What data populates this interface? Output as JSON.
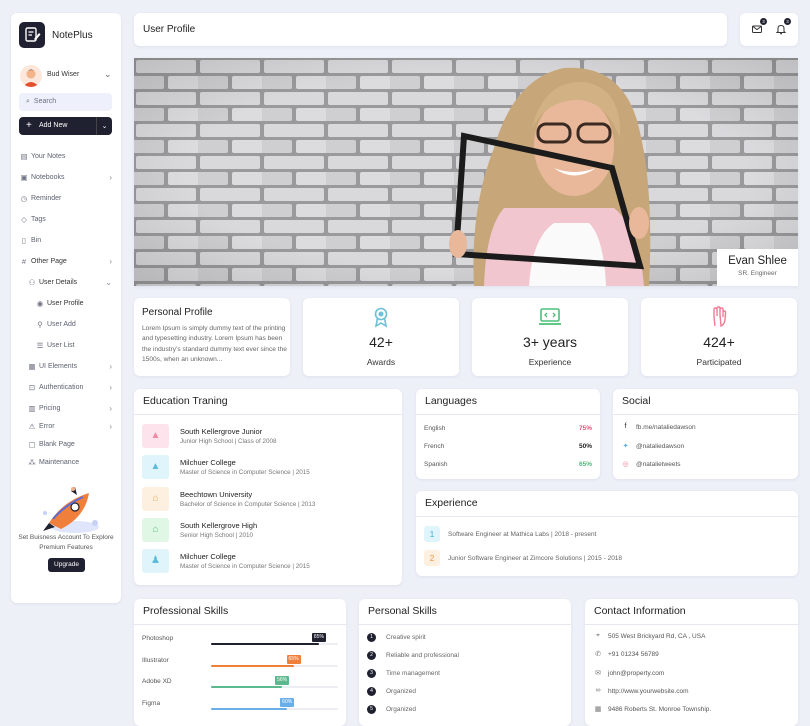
{
  "app": {
    "name": "NotePlus"
  },
  "user": {
    "name": "Bud Wiser"
  },
  "search": {
    "placeholder": "Search"
  },
  "add_new": {
    "label": "Add New"
  },
  "sidebar": {
    "items": [
      {
        "label": "Your Notes",
        "icon": "notes-icon",
        "chevron": false
      },
      {
        "label": "Notebooks",
        "icon": "notebook-icon",
        "chevron": true
      },
      {
        "label": "Reminder",
        "icon": "clock-icon",
        "chevron": false
      },
      {
        "label": "Tags",
        "icon": "tag-icon",
        "chevron": false
      },
      {
        "label": "Bin",
        "icon": "trash-icon",
        "chevron": false
      },
      {
        "label": "Other Page",
        "icon": "hash-icon",
        "chevron": true
      },
      {
        "label": "User Details",
        "icon": "users-icon",
        "chevron": true
      },
      {
        "label": "User Profile",
        "icon": "user-circle-icon",
        "chevron": false
      },
      {
        "label": "User Add",
        "icon": "user-add-icon",
        "chevron": false
      },
      {
        "label": "User List",
        "icon": "list-icon",
        "chevron": false
      },
      {
        "label": "UI Elements",
        "icon": "ui-icon",
        "chevron": true
      },
      {
        "label": "Authentication",
        "icon": "lock-icon",
        "chevron": true
      },
      {
        "label": "Pricing",
        "icon": "pricing-icon",
        "chevron": true
      },
      {
        "label": "Error",
        "icon": "error-icon",
        "chevron": true
      },
      {
        "label": "Blank Page",
        "icon": "blank-page-icon",
        "chevron": false
      },
      {
        "label": "Maintenance",
        "icon": "maintenance-icon",
        "chevron": false
      }
    ],
    "promo_text": "Set Buisness Account To Explore Premium Features",
    "upgrade_label": "Upgrade"
  },
  "header": {
    "title": "User Profile",
    "mail_badge": "3",
    "bell_badge": "3"
  },
  "hero": {
    "name": "Evan Shlee",
    "role": "SR. Engineer"
  },
  "personal_profile": {
    "title": "Personal Profile",
    "text": "Lorem Ipsum is simply dummy text of the printing and typesetting industry. Lorem Ipsum has been the industry's standard dummy text ever since the 1500s, when an unknown..."
  },
  "stats": [
    {
      "value": "42+",
      "label": "Awards",
      "icon": "award-icon",
      "color": "#6dc0d5"
    },
    {
      "value": "3+ years",
      "label": "Experience",
      "icon": "laptop-code-icon",
      "color": "#4cc07a"
    },
    {
      "value": "424+",
      "label": "Participated",
      "icon": "hand-icon",
      "color": "#ef7b95"
    }
  ],
  "education": {
    "title": "Education Traning",
    "items": [
      {
        "name": "South Kellergrove Junior",
        "detail": "Junior High School | Class of 2008",
        "bg": "#fde4ec",
        "fg": "#ef8aa6",
        "icon": "graduation-cap-icon"
      },
      {
        "name": "Milchuer College",
        "detail": "Master of Science in Computer Science | 2015",
        "bg": "#dff4fb",
        "fg": "#5bbbd8",
        "icon": "graduation-cap-icon"
      },
      {
        "name": "Beechtown University",
        "detail": "Bachelor of Science in Computer Science | 2013",
        "bg": "#fdf0e0",
        "fg": "#f2a95a",
        "icon": "university-icon"
      },
      {
        "name": "South Kellergrove High",
        "detail": "Senior High School | 2010",
        "bg": "#e1f7e6",
        "fg": "#56c27a",
        "icon": "school-icon"
      },
      {
        "name": "Milchuer College",
        "detail": "Master of Science in Computer Science | 2015",
        "bg": "#dff4fb",
        "fg": "#5bbbd8",
        "icon": "graduate-icon"
      }
    ]
  },
  "languages": {
    "title": "Languages",
    "items": [
      {
        "name": "English",
        "percent": "75%",
        "color": "#e8527a"
      },
      {
        "name": "French",
        "percent": "50%",
        "color": "#222222"
      },
      {
        "name": "Spanish",
        "percent": "65%",
        "color": "#4cb878"
      }
    ]
  },
  "social": {
    "title": "Social",
    "items": [
      {
        "text": "fb.me/nataliedawson",
        "icon": "facebook-icon",
        "color": "#222222"
      },
      {
        "text": "@nataliedawson",
        "icon": "twitter-icon",
        "color": "#5aa9e6"
      },
      {
        "text": "@natalietweets",
        "icon": "instagram-icon",
        "color": "#ef7b95"
      }
    ]
  },
  "experience": {
    "title": "Experience",
    "items": [
      {
        "num": "1",
        "text": "Software Engineer at Mathica Labs | 2018 - present",
        "bg": "#dff4fb",
        "fg": "#4aaed0"
      },
      {
        "num": "2",
        "text": "Junior Software Engineer at Zimcore Solutions | 2015 - 2018",
        "bg": "#fdf0e0",
        "fg": "#e89548"
      }
    ]
  },
  "professional_skills": {
    "title": "Professional Skills",
    "items": [
      {
        "name": "Photoshop",
        "percent": 85,
        "label": "85%",
        "color": "#1f2030"
      },
      {
        "name": "Illustrator",
        "percent": 65,
        "label": "65%",
        "color": "#f07f3c"
      },
      {
        "name": "Adobe XD",
        "percent": 56,
        "label": "56%",
        "color": "#5cb98d"
      },
      {
        "name": "Figma",
        "percent": 60,
        "label": "60%",
        "color": "#6aaee8"
      }
    ]
  },
  "personal_skills": {
    "title": "Personal Skills",
    "items": [
      {
        "num": "1",
        "text": "Creative spirit"
      },
      {
        "num": "2",
        "text": "Reliable and professional"
      },
      {
        "num": "3",
        "text": "Time management"
      },
      {
        "num": "4",
        "text": "Organized"
      },
      {
        "num": "5",
        "text": "Organized"
      }
    ]
  },
  "contact": {
    "title": "Contact Information",
    "items": [
      {
        "text": "505 West Brickyard Rd, CA , USA",
        "icon": "location-icon"
      },
      {
        "text": "+91 01234 56789",
        "icon": "phone-icon"
      },
      {
        "text": "john@property.com",
        "icon": "email-icon"
      },
      {
        "text": "http://www.yourwebsite.com",
        "icon": "link-icon"
      },
      {
        "text": "9486 Roberts St. Monroe Township.",
        "icon": "building-icon"
      }
    ]
  }
}
